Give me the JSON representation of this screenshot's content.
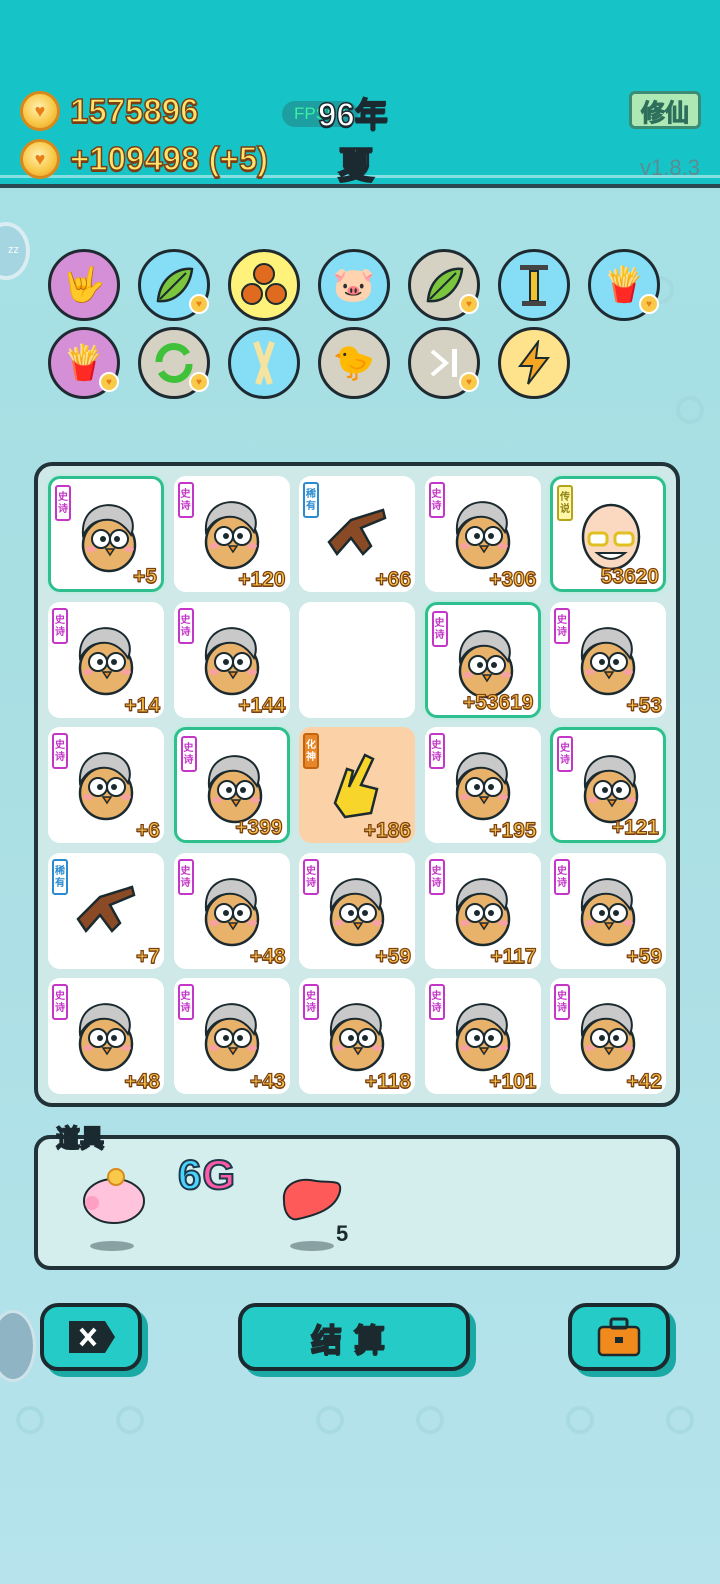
{
  "header": {
    "coins": "1575896",
    "income": "+109498 (+5)",
    "fps": "FPS60",
    "year": "96年",
    "season": "夏",
    "cultivate_button": "修仙",
    "version": "v1.8.3"
  },
  "skills": [
    {
      "icon": "rock-hand-icon"
    },
    {
      "icon": "leaf-icon"
    },
    {
      "icon": "basketballs-icon"
    },
    {
      "icon": "piggy-bank-icon"
    },
    {
      "icon": "leaf-icon"
    },
    {
      "icon": "pump-icon"
    },
    {
      "icon": "fries-icon"
    },
    {
      "icon": "fries-icon"
    },
    {
      "icon": "refresh-icon"
    },
    {
      "icon": "sticks-icon"
    },
    {
      "icon": "chick-icon"
    },
    {
      "icon": "skip-icon"
    },
    {
      "icon": "lightning-icon"
    }
  ],
  "board": {
    "cells": [
      {
        "tag": "史诗",
        "value": "+5"
      },
      {
        "tag": "史诗",
        "value": "+120"
      },
      {
        "tag": "稀有",
        "value": "+66"
      },
      {
        "tag": "史诗",
        "value": "+306"
      },
      {
        "tag": "传说",
        "value": "53620"
      },
      {
        "tag": "史诗",
        "value": "+14"
      },
      {
        "tag": "史诗",
        "value": "+144"
      },
      {
        "tag": "",
        "value": ""
      },
      {
        "tag": "史诗",
        "value": "+53619"
      },
      {
        "tag": "史诗",
        "value": "+53"
      },
      {
        "tag": "史诗",
        "value": "+6"
      },
      {
        "tag": "史诗",
        "value": "+399"
      },
      {
        "tag": "化神",
        "value": "+186"
      },
      {
        "tag": "史诗",
        "value": "+195"
      },
      {
        "tag": "史诗",
        "value": "+121"
      },
      {
        "tag": "稀有",
        "value": "+7"
      },
      {
        "tag": "史诗",
        "value": "+48"
      },
      {
        "tag": "史诗",
        "value": "+59"
      },
      {
        "tag": "史诗",
        "value": "+117"
      },
      {
        "tag": "史诗",
        "value": "+59"
      },
      {
        "tag": "史诗",
        "value": "+48"
      },
      {
        "tag": "史诗",
        "value": "+43"
      },
      {
        "tag": "史诗",
        "value": "+118"
      },
      {
        "tag": "史诗",
        "value": "+101"
      },
      {
        "tag": "史诗",
        "value": "+42"
      }
    ]
  },
  "props": {
    "title": "道具",
    "items": [
      {
        "icon": "piggy-bank-icon"
      },
      {
        "icon": "6g-icon",
        "label": "6G"
      },
      {
        "icon": "liver-icon",
        "count": "5"
      }
    ]
  },
  "buttons": {
    "settle": "结算"
  },
  "colors": {
    "header": "#16c4c7",
    "button": "#25cbc6",
    "coin_text": "#ffe36c",
    "epic_tag": "#c436c8",
    "rare_tag": "#2a8bd1"
  }
}
